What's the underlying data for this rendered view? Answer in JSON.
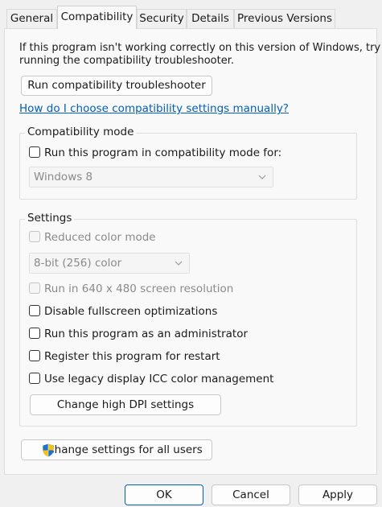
{
  "tabs": [
    {
      "label": "General"
    },
    {
      "label": "Compatibility"
    },
    {
      "label": "Security"
    },
    {
      "label": "Details"
    },
    {
      "label": "Previous Versions"
    }
  ],
  "intro": {
    "line1": "If this program isn't working correctly on this version of Windows, try",
    "line2": "running the compatibility troubleshooter."
  },
  "troubleshooter_button": "Run compatibility troubleshooter",
  "help_link": "How do I choose compatibility settings manually?",
  "compat_mode": {
    "legend": "Compatibility mode",
    "checkbox_label": "Run this program in compatibility mode for:",
    "checked": false,
    "os_select": "Windows 8"
  },
  "settings": {
    "legend": "Settings",
    "reduced_color": {
      "label": "Reduced color mode",
      "checked": false,
      "disabled": true
    },
    "color_select": "8-bit (256) color",
    "res_640": {
      "label": "Run in 640 x 480 screen resolution",
      "checked": false,
      "disabled": true
    },
    "fullscreen_opt": {
      "label": "Disable fullscreen optimizations",
      "checked": false
    },
    "run_admin": {
      "label": "Run this program as an administrator",
      "checked": false
    },
    "register_restart": {
      "label": "Register this program for restart",
      "checked": false
    },
    "legacy_icc": {
      "label": "Use legacy display ICC color management",
      "checked": false
    },
    "dpi_button": "Change high DPI settings"
  },
  "all_users_button": "Change settings for all users",
  "dialog_buttons": {
    "ok": "OK",
    "cancel": "Cancel",
    "apply": "Apply"
  },
  "colors": {
    "accent": "#005fb8",
    "link": "#005fb8",
    "disabled_text": "#8a8a8a"
  }
}
